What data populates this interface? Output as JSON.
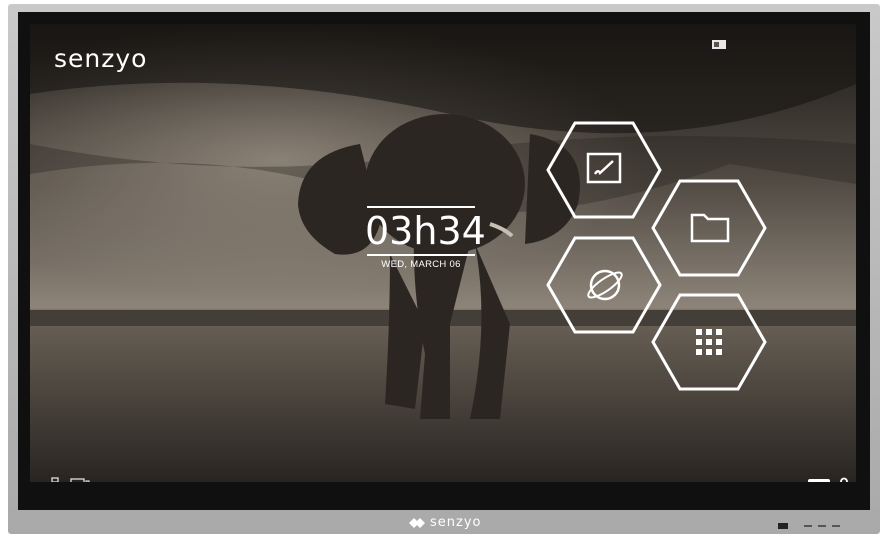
{
  "screen": {
    "brand": "senzyo",
    "clock": {
      "time": "03h34",
      "date": "WED, MARCH 06"
    },
    "apps": [
      {
        "name": "whiteboard",
        "icon": "whiteboard-icon"
      },
      {
        "name": "files",
        "icon": "folder-icon"
      },
      {
        "name": "browser",
        "icon": "globe-icon"
      },
      {
        "name": "all-apps",
        "icon": "app-grid-icon"
      }
    ],
    "status_icons": {
      "top_right": "cast-icon",
      "bottom_left": [
        "network-icon",
        "input-source-icon"
      ],
      "bottom_right": [
        "keyboard-icon",
        "lock-icon"
      ]
    }
  },
  "bezel": {
    "logo_text": "senzyo"
  },
  "colors": {
    "bezel": "#b8b8b8",
    "screen_border": "#101010",
    "ui_white": "#ffffff"
  }
}
